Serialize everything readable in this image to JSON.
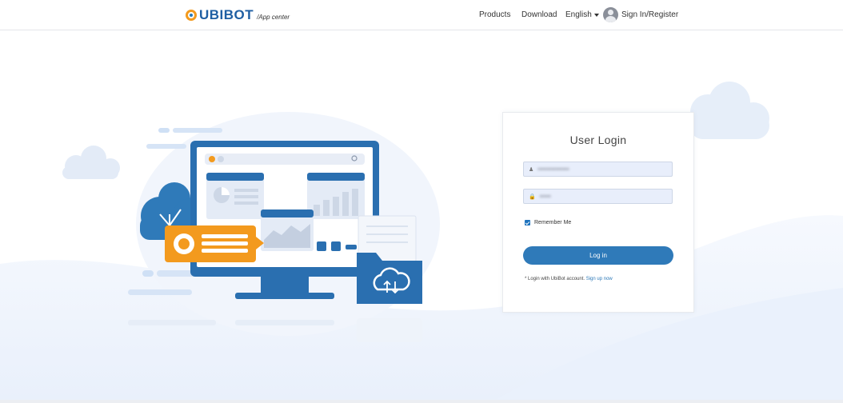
{
  "header": {
    "logo_text": "UBIBOT",
    "logo_sub": "/App center",
    "nav": {
      "products": "Products",
      "download": "Download",
      "language": "English",
      "sign_in": "Sign In/Register"
    }
  },
  "login": {
    "title": "User Login",
    "username_value": "••••••••••••••",
    "password_value": "•••••",
    "remember_label": "Remember Me",
    "remember_checked": true,
    "button_label": "Log in",
    "note_text": "* Login with UbiBot account.",
    "note_link": "Sign up now"
  },
  "colors": {
    "brand_blue": "#2f7ab9",
    "brand_orange": "#f39a1e",
    "field_bg": "#e8eefb"
  },
  "icons": {
    "user": "user-icon",
    "lock": "lock-icon",
    "caret": "caret-down-icon",
    "avatar": "avatar-icon"
  }
}
